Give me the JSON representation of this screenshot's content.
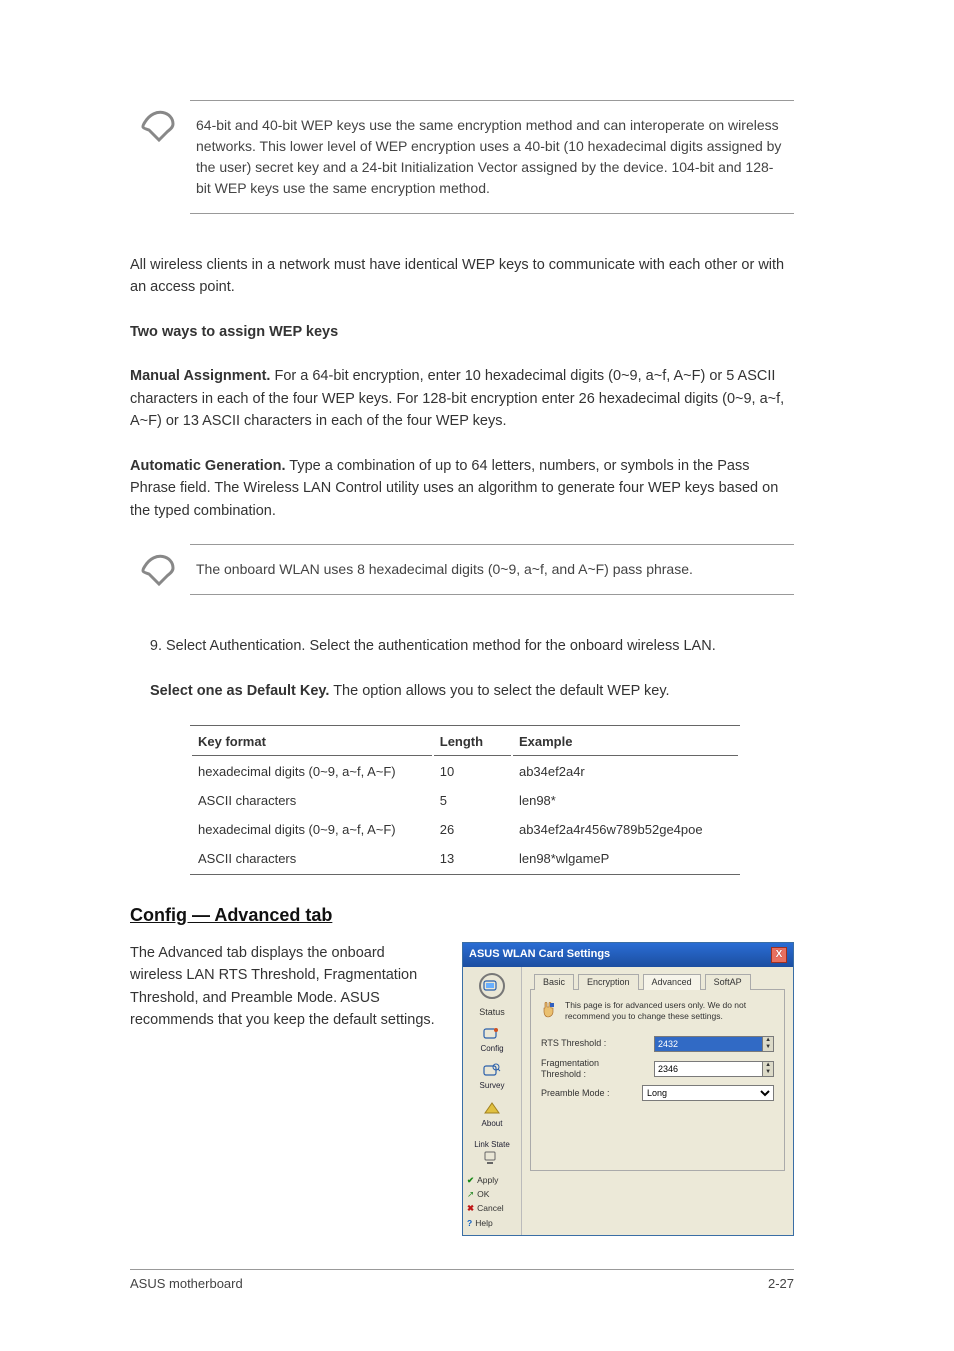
{
  "notes": {
    "note1": "64-bit and 40-bit WEP keys use the same encryption method and can interoperate on wireless networks. This lower level of WEP encryption uses a 40-bit (10 hexadecimal digits assigned by the user) secret key and a 24-bit Initialization Vector assigned by the device. 104-bit and 128-bit WEP keys use the same encryption method.",
    "note2": "The onboard WLAN uses 8 hexadecimal digits (0~9, a~f, and A~F) pass phrase."
  },
  "paragraphs": {
    "p1": "All wireless clients in a network must have identical WEP keys to communicate with each other or with an access point.",
    "p1b": "Two ways to assign WEP keys",
    "p2_label": "Manual Assignment.",
    "p2": " For a 64-bit encryption, enter 10 hexadecimal digits (0~9, a~f, A~F) or 5 ASCII characters in each of the four WEP keys. For 128-bit encryption enter 26 hexadecimal digits (0~9, a~f, A~F) or 13 ASCII characters in each of the four WEP keys.",
    "p3_label": "Automatic Generation.",
    "p3": " Type a combination of up to 64 letters, numbers, or symbols in the Pass Phrase field. The Wireless LAN Control utility uses an algorithm to generate four WEP keys based on the typed combination.",
    "p4": "Select Authentication. Select the authentication method for the onboard wireless LAN.",
    "p5_label": "Select one as Default Key.",
    "p5": " The option allows you to select the default WEP key."
  },
  "table": {
    "headers": [
      "Key format",
      "Length",
      "Example"
    ],
    "rows": [
      [
        "hexadecimal digits (0~9, a~f, A~F)",
        "10",
        "ab34ef2a4r"
      ],
      [
        "ASCII characters",
        "5",
        "len98*"
      ],
      [
        "hexadecimal digits (0~9, a~f, A~F)",
        "26",
        "ab34ef2a4r456w789b52ge4poe"
      ],
      [
        "ASCII characters",
        "13",
        "len98*wlgameP"
      ]
    ]
  },
  "advanced": {
    "heading": "Config — Advanced tab",
    "body": "The Advanced tab displays the onboard wireless LAN RTS Threshold, Fragmentation Threshold, and Preamble Mode. ASUS recommends that you keep the default settings."
  },
  "window": {
    "title": "ASUS WLAN Card Settings",
    "close": "X",
    "sidebar": {
      "items": [
        {
          "label": "Status"
        },
        {
          "label": "Config"
        },
        {
          "label": "Survey"
        },
        {
          "label": "About"
        },
        {
          "label": "Link State"
        }
      ],
      "buttons": {
        "apply": "Apply",
        "ok": "OK",
        "cancel": "Cancel",
        "help": "Help"
      }
    },
    "tabs": [
      "Basic",
      "Encryption",
      "Advanced",
      "SoftAP"
    ],
    "active_tab": 2,
    "note": "This page is for advanced users only. We do not recommend you to change these settings.",
    "fields": {
      "rts_label": "RTS Threshold :",
      "rts_value": "2432",
      "frag_label": "Fragmentation Threshold :",
      "frag_value": "2346",
      "preamble_label": "Preamble Mode :",
      "preamble_value": "Long"
    }
  },
  "footer": {
    "left": "ASUS motherboard",
    "right": "2-27"
  }
}
